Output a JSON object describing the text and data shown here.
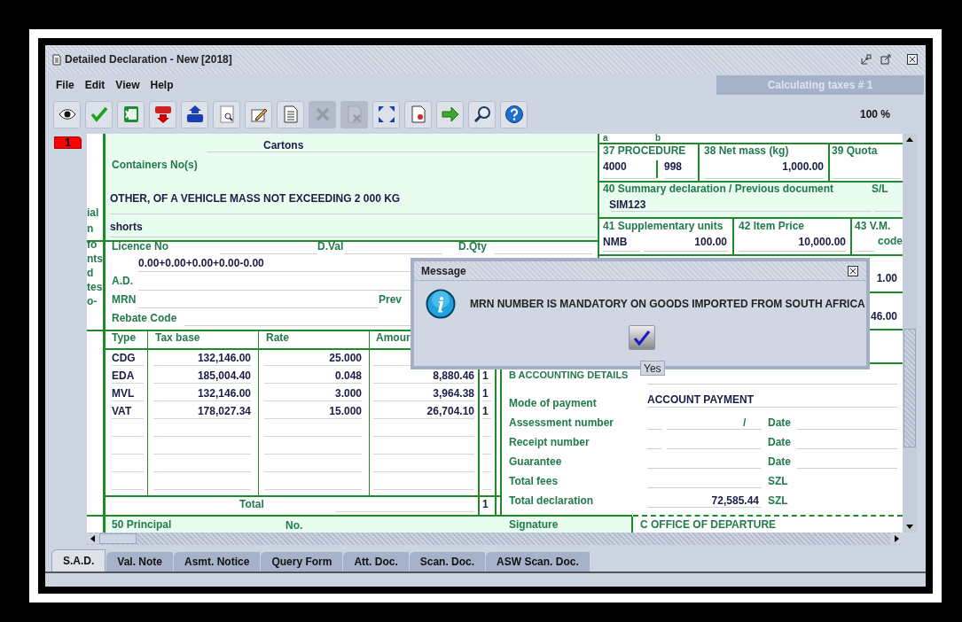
{
  "window": {
    "title": "Detailed Declaration - New [2018]"
  },
  "menu": [
    "File",
    "Edit",
    "View",
    "Help"
  ],
  "status_text": "Calculating taxes # 1",
  "toolbar": [
    {
      "kind": "eye",
      "disabled": false
    },
    {
      "kind": "check",
      "disabled": false
    },
    {
      "kind": "excel",
      "disabled": false
    },
    {
      "kind": "xml-down",
      "disabled": false
    },
    {
      "kind": "xml-up",
      "disabled": false
    },
    {
      "kind": "preview",
      "disabled": false
    },
    {
      "kind": "edit",
      "disabled": false
    },
    {
      "kind": "document",
      "disabled": false
    },
    {
      "kind": "delete",
      "disabled": true
    },
    {
      "kind": "document-x",
      "disabled": true
    },
    {
      "kind": "expand",
      "disabled": false
    },
    {
      "kind": "document-red",
      "disabled": false
    },
    {
      "kind": "forward",
      "disabled": false
    },
    {
      "kind": "search",
      "disabled": false
    },
    {
      "kind": "help",
      "disabled": false
    }
  ],
  "zoom": "100 %",
  "item_tab": "1",
  "form": {
    "side_labels": [
      "ial",
      "n",
      "fo",
      "nts",
      "d",
      "tes",
      "o-"
    ],
    "goods": {
      "kind_of_packages": "Cartons",
      "containers_label": "Containers No(s)",
      "description": "OTHER, OF A VEHICLE MASS NOT EXCEEDING 2 000 KG",
      "commercial_description": "shorts"
    },
    "licence": {
      "licence_label": "Licence No",
      "dval_label": "D.Val",
      "dqty_label": "D.Qty",
      "value_formula": "0.00+0.00+0.00+0.00-0.00",
      "ad_label": "A.D.",
      "mrn_label": "MRN",
      "prev_label": "Prev",
      "rebate_label": "Rebate Code"
    },
    "taxes": {
      "columns": [
        "Type",
        "Tax base",
        "Rate",
        "Amour"
      ],
      "rows": [
        {
          "type": "CDG",
          "tax_base": "132,146.00",
          "rate": "25.000"
        },
        {
          "type": "EDA",
          "tax_base": "185,004.40",
          "rate": "0.048",
          "amount": "8,880.46",
          "mp": "1"
        },
        {
          "type": "MVL",
          "tax_base": "132,146.00",
          "rate": "3.000",
          "amount": "3,964.38",
          "mp": "1"
        },
        {
          "type": "VAT",
          "tax_base": "178,027.34",
          "rate": "15.000",
          "amount": "26,704.10",
          "mp": "1"
        }
      ],
      "total_label": "Total",
      "total_mp": "1"
    },
    "box_a": "a",
    "box_b": "b",
    "procedure": {
      "label": "37 PROCEDURE",
      "code": "4000",
      "extra": "998"
    },
    "net_mass": {
      "label": "38 Net mass (kg)",
      "value": "1,000.00"
    },
    "quota": {
      "label": "39 Quota"
    },
    "summary": {
      "label": "40 Summary declaration / Previous document",
      "sl_label": "S/L",
      "value": "SIM123"
    },
    "supplementary": {
      "label": "41 Supplementary units",
      "unit": "NMB",
      "value": "100.00"
    },
    "item_price": {
      "label": "42 Item Price",
      "value": "10,000.00"
    },
    "vm": {
      "label": "43 V.M.",
      "code_label": "code"
    },
    "partial_values": [
      "1.00",
      "46.00"
    ],
    "accounting": {
      "title": "B ACCOUNTING DETAILS",
      "rows": [
        {
          "kind": "value",
          "label": "Mode of payment",
          "value": "ACCOUNT PAYMENT"
        },
        {
          "kind": "assessment",
          "label": "Assessment number",
          "separator": "/",
          "suffix": "Date"
        },
        {
          "kind": "receipt",
          "label": "Receipt number",
          "suffix": "Date"
        },
        {
          "kind": "single",
          "label": "Guarantee",
          "suffix": "Date"
        },
        {
          "kind": "amount",
          "label": "Total fees",
          "suffix": "SZL"
        },
        {
          "kind": "amount",
          "label": "Total declaration",
          "value": "72,585.44",
          "suffix": "SZL"
        }
      ]
    },
    "footer": {
      "principal": "50 Principal",
      "no": "No.",
      "signature": "Signature",
      "office": "C OFFICE OF DEPARTURE"
    }
  },
  "dialog": {
    "title": "Message",
    "message": "MRN NUMBER IS MANDATORY ON GOODS IMPORTED FROM SOUTH AFRICA",
    "tooltip": "Yes"
  },
  "tabs": [
    {
      "label": "S.A.D.",
      "selected": true
    },
    {
      "label": "Val. Note",
      "selected": false
    },
    {
      "label": "Asmt. Notice",
      "selected": false
    },
    {
      "label": "Query Form",
      "selected": false
    },
    {
      "label": "Att. Doc.",
      "selected": false
    },
    {
      "label": "Scan. Doc.",
      "selected": false
    },
    {
      "label": "ASW Scan. Doc.",
      "selected": false
    }
  ]
}
